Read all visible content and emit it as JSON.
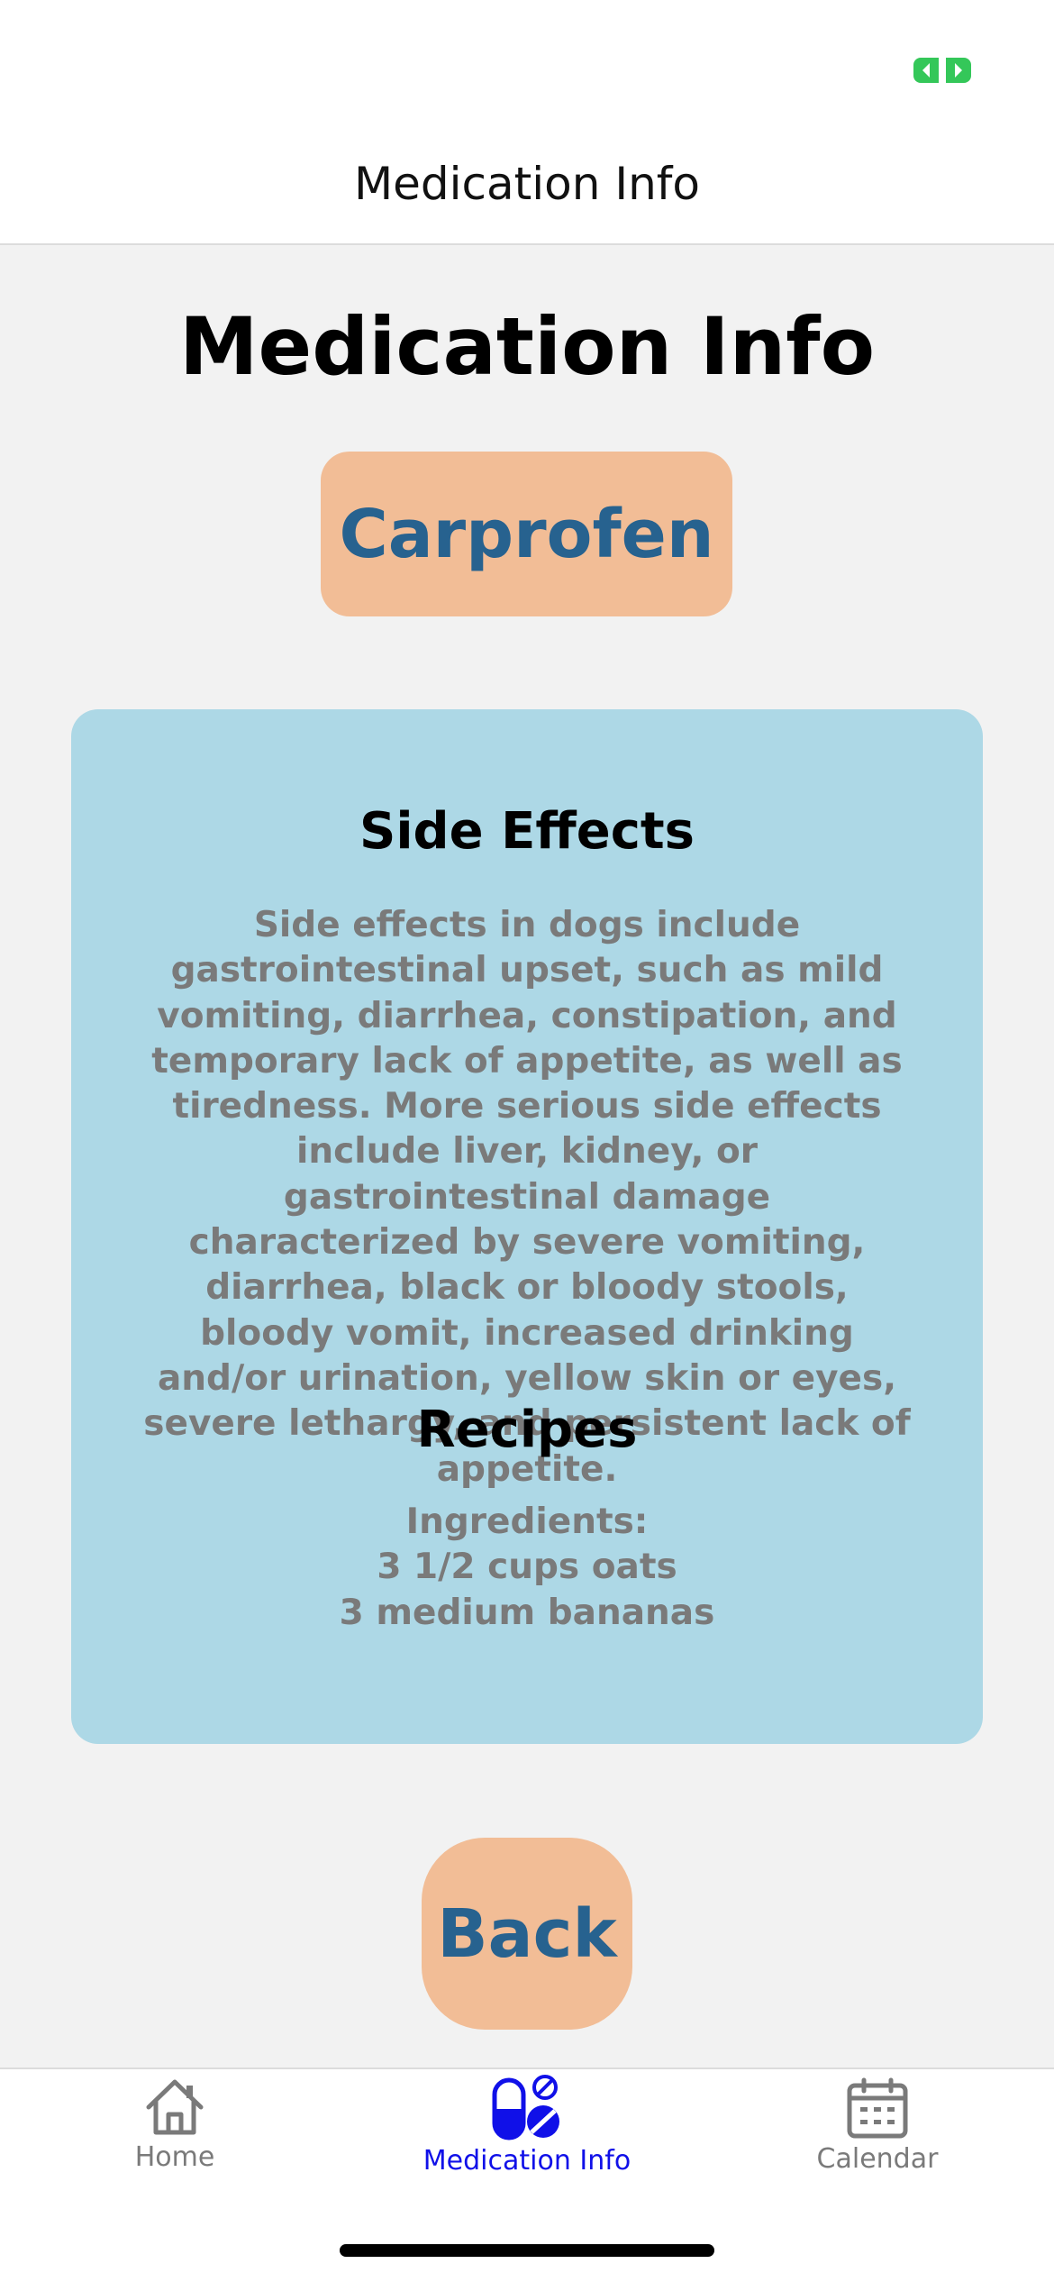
{
  "status_bar": {
    "indicator_icon": "battery-indicator-icon",
    "indicator_color": "#34c759"
  },
  "header": {
    "title": "Medication Info"
  },
  "main": {
    "page_title": "Medication Info",
    "medication_name": "Carprofen",
    "sections": [
      {
        "heading": "Side Effects",
        "body": "Side effects in dogs include gastrointestinal upset, such as mild vomiting, diarrhea, constipation, and temporary lack of appetite, as well as tiredness. More serious side effects include liver, kidney, or gastrointestinal damage characterized by severe vomiting, diarrhea, black or bloody stools, bloody vomit, increased drinking and/or urination, yellow skin or eyes, severe lethargy, and persistent lack of appetite."
      },
      {
        "heading": "Recipes",
        "body": "Ingredients:\n3 1/2 cups oats\n3 medium bananas"
      }
    ],
    "back_label": "Back"
  },
  "tab_bar": {
    "tabs": [
      {
        "label": "Home",
        "icon": "home-icon",
        "active": false
      },
      {
        "label": "Medication Info",
        "icon": "pills-icon",
        "active": true
      },
      {
        "label": "Calendar",
        "icon": "calendar-icon",
        "active": false
      }
    ]
  },
  "colors": {
    "background": "#f2f2f2",
    "card": "#add8e6",
    "accent_button": "#f2bd96",
    "accent_text": "#27628f",
    "body_text": "#7a7a7a",
    "active_tab": "#1010e8",
    "inactive_tab": "#7a7a7a"
  }
}
